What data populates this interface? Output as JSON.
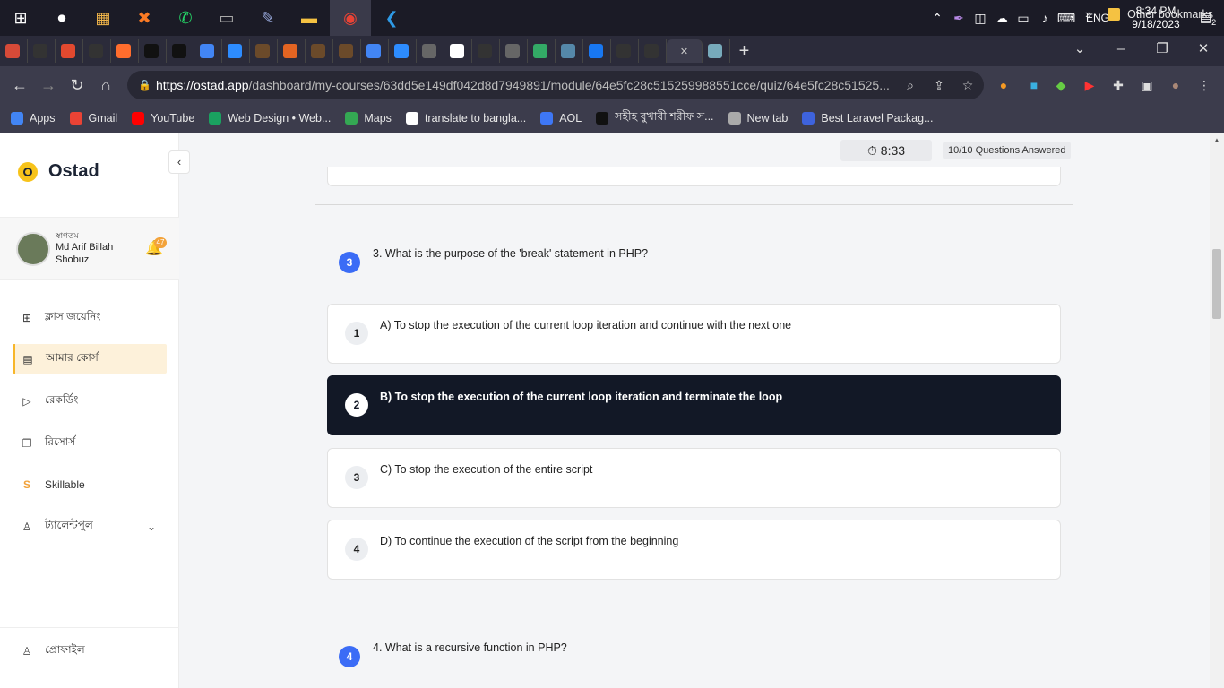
{
  "taskbar": {
    "icons": [
      "windows-start",
      "obs",
      "store",
      "xampp",
      "whatsapp",
      "files",
      "notepad",
      "explorer",
      "chrome",
      "vscode"
    ],
    "system": {
      "lang": "ENG",
      "time": "8:34 PM",
      "date": "9/18/2023",
      "notif_count": "2"
    }
  },
  "browser": {
    "url_host": "https://ostad.app",
    "url_path": "/dashboard/my-courses/63dd5e149df042d8d7949891/module/64e5fc28c515259988551cce/quiz/64e5fc28c51525...",
    "new_tab": "+",
    "bookmarks": [
      {
        "label": "Apps",
        "color": "#4285f4"
      },
      {
        "label": "Gmail",
        "color": "#ea4335"
      },
      {
        "label": "YouTube",
        "color": "#ff0000"
      },
      {
        "label": "Web Design • Web...",
        "color": "#1aa260"
      },
      {
        "label": "Maps",
        "color": "#34a853"
      },
      {
        "label": "translate to bangla...",
        "color": "#ffffff"
      },
      {
        "label": "AOL",
        "color": "#3e77f5"
      },
      {
        "label": "সহীহ বুখারী শরীফ স...",
        "color": "#111111"
      },
      {
        "label": "New tab",
        "color": "#aaaaaa"
      },
      {
        "label": "Best Laravel Packag...",
        "color": "#3e63dd"
      }
    ],
    "bookmarks_more": "»",
    "other_bookmarks": "Other bookmarks"
  },
  "sidebar": {
    "brand": "Ostad",
    "user": {
      "welcome": "স্বাগতম",
      "name": "Md Arif Billah Shobuz",
      "notifications": "47"
    },
    "menu": [
      {
        "label": "ক্লাস জয়েনিং",
        "icon": "join-class-icon",
        "active": false
      },
      {
        "label": "আমার কোর্স",
        "icon": "book-icon",
        "active": true
      },
      {
        "label": "রেকর্ডিং",
        "icon": "play-icon",
        "active": false
      },
      {
        "label": "রিসোর্স",
        "icon": "resource-icon",
        "active": false
      },
      {
        "label": "Skillable",
        "icon": "skillable-icon",
        "active": false
      },
      {
        "label": "ট্যালেন্টপুল",
        "icon": "talent-icon",
        "active": false
      }
    ],
    "profile": "প্রোফাইল"
  },
  "quiz": {
    "timer": "8:33",
    "answered": "10/10 Questions Answered",
    "question3": {
      "number": "3",
      "text": "3. What is the purpose of the 'break' statement in PHP?",
      "options": [
        {
          "n": "1",
          "text": "A) To stop the execution of the current loop iteration and continue with the next one"
        },
        {
          "n": "2",
          "text": "B) To stop the execution of the current loop iteration and terminate the loop"
        },
        {
          "n": "3",
          "text": "C) To stop the execution of the entire script"
        },
        {
          "n": "4",
          "text": "D) To continue the execution of the script from the beginning"
        }
      ],
      "selected": "2"
    },
    "question4": {
      "number": "4",
      "text": "4. What is a recursive function in PHP?"
    }
  }
}
